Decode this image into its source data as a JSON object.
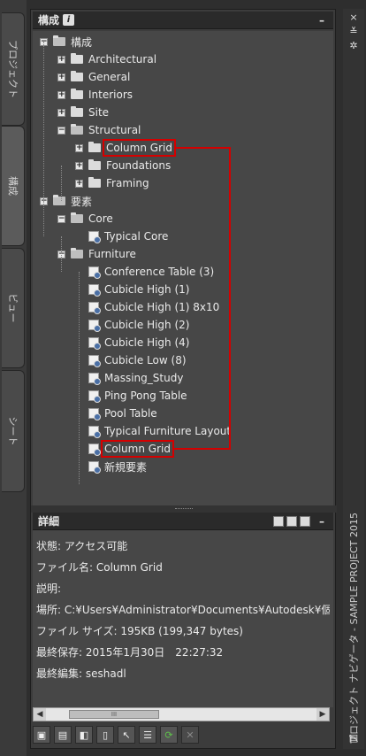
{
  "side_tabs": [
    "プロジェクト",
    "構成",
    "ビュー",
    "シート"
  ],
  "tree_header": {
    "title": "構成",
    "minimize": "–"
  },
  "tree": [
    {
      "label": "構成",
      "level": 0,
      "type": "folder-open",
      "exp": "−"
    },
    {
      "label": "Architectural",
      "level": 1,
      "type": "folder",
      "exp": "+"
    },
    {
      "label": "General",
      "level": 1,
      "type": "folder",
      "exp": "+"
    },
    {
      "label": "Interiors",
      "level": 1,
      "type": "folder",
      "exp": "+"
    },
    {
      "label": "Site",
      "level": 1,
      "type": "folder",
      "exp": "+"
    },
    {
      "label": "Structural",
      "level": 1,
      "type": "folder-open",
      "exp": "−"
    },
    {
      "label": "Column Grid",
      "level": 2,
      "type": "folder",
      "exp": "+",
      "highlight": true
    },
    {
      "label": "Foundations",
      "level": 2,
      "type": "folder",
      "exp": "+"
    },
    {
      "label": "Framing",
      "level": 2,
      "type": "folder",
      "exp": "+"
    },
    {
      "label": "要素",
      "level": 0,
      "type": "folder-open",
      "exp": "−"
    },
    {
      "label": "Core",
      "level": 1,
      "type": "folder-open",
      "exp": "−"
    },
    {
      "label": "Typical Core",
      "level": 2,
      "type": "item"
    },
    {
      "label": "Furniture",
      "level": 1,
      "type": "folder-open",
      "exp": "−"
    },
    {
      "label": "Conference Table (3)",
      "level": 2,
      "type": "item"
    },
    {
      "label": "Cubicle High (1)",
      "level": 2,
      "type": "item"
    },
    {
      "label": "Cubicle High (1) 8x10",
      "level": 2,
      "type": "item"
    },
    {
      "label": "Cubicle High (2)",
      "level": 2,
      "type": "item"
    },
    {
      "label": "Cubicle High (4)",
      "level": 2,
      "type": "item"
    },
    {
      "label": "Cubicle Low (8)",
      "level": 2,
      "type": "item"
    },
    {
      "label": "Massing_Study",
      "level": 2,
      "type": "item"
    },
    {
      "label": "Ping Pong Table",
      "level": 2,
      "type": "item"
    },
    {
      "label": "Pool Table",
      "level": 2,
      "type": "item"
    },
    {
      "label": "Typical Furniture Layout",
      "level": 2,
      "type": "item"
    },
    {
      "label": "Column Grid",
      "level": 2,
      "type": "item",
      "highlight": true
    },
    {
      "label": "新規要素",
      "level": 2,
      "type": "item"
    }
  ],
  "details_header": {
    "title": "詳細",
    "minimize": "–"
  },
  "details": [
    "状態: アクセス可能",
    "ファイル名: Column Grid",
    "説明:",
    "場所: C:¥Users¥Administrator¥Documents¥Autodesk¥個人",
    "ファイル サイズ: 195KB (199,347 bytes)",
    "最終保存: 2015年1月30日　22:27:32",
    "最終編集: seshadl"
  ],
  "scroll_thumb": "III",
  "toolbar_icons": [
    "new-folder-icon",
    "new-category-icon",
    "new-element-icon",
    "copy-icon",
    "select-icon",
    "properties-icon",
    "refresh-icon",
    "delete-icon"
  ],
  "right_strip": {
    "close": "×",
    "autohide": "≚",
    "settings": "✲",
    "title": "プロジェクト ナビゲータ - SAMPLE PROJECT 2015"
  },
  "colors": {
    "highlight": "#d40000",
    "background": "#474747"
  }
}
